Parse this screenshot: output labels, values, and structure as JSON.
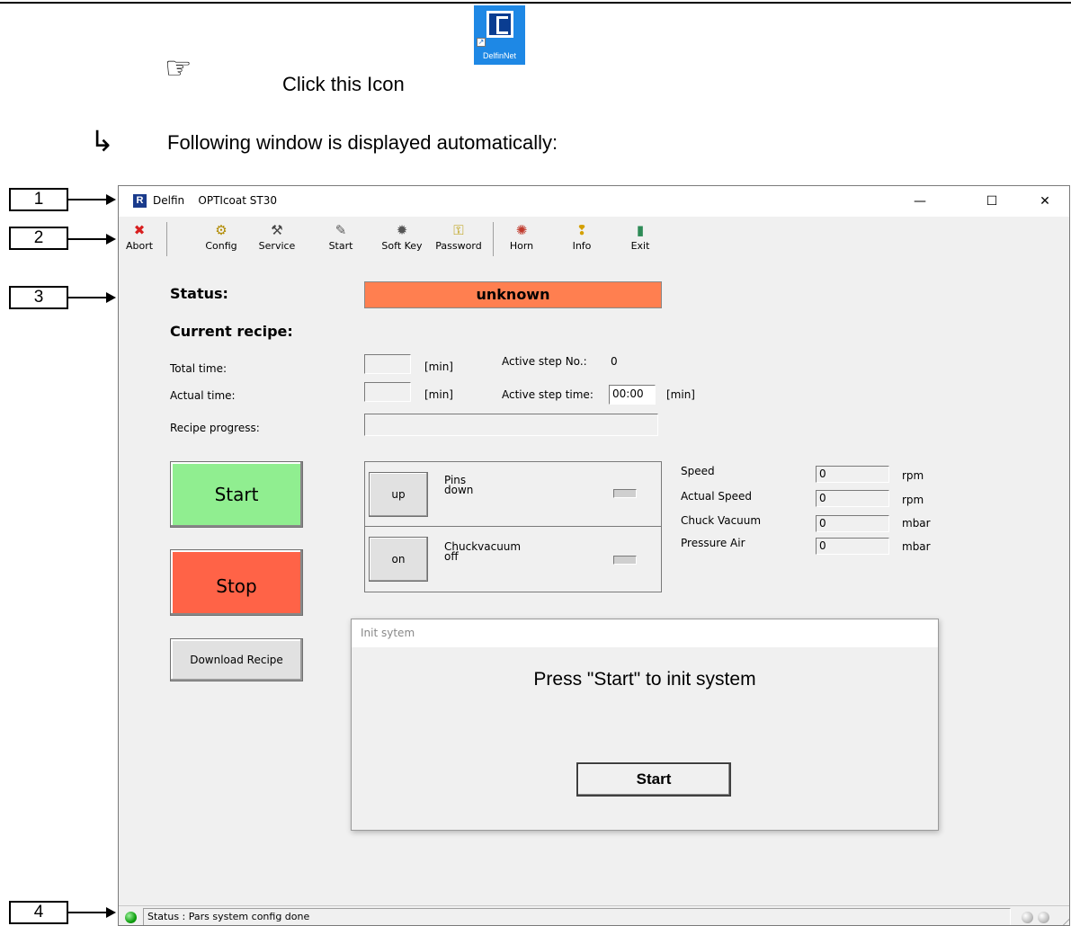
{
  "hint": {
    "hand_glyph": "☞",
    "text": "Click this Icon",
    "icon_caption": "DelfinNet",
    "icon_name": "delfinnet-app-icon"
  },
  "result": {
    "arrow_glyph": "↳",
    "text": "Following window is displayed automatically:"
  },
  "callouts": [
    "1",
    "2",
    "3",
    "4"
  ],
  "window": {
    "app_name": "Delfin",
    "title": "OPTIcoat ST30",
    "minimize_glyph": "—",
    "maximize_glyph": "☐",
    "close_glyph": "✕"
  },
  "toolbar": [
    {
      "label": "Abort",
      "icon": "abort-icon",
      "glyph": "✖",
      "color": "#d81f1f"
    },
    {
      "label": "Config",
      "icon": "config-icon",
      "glyph": "⚙",
      "color": "#b08a00"
    },
    {
      "label": "Service",
      "icon": "service-icon",
      "glyph": "⚒",
      "color": "#444444"
    },
    {
      "label": "Start",
      "icon": "start-icon",
      "glyph": "✎",
      "color": "#5a5a5a"
    },
    {
      "label": "Soft Key",
      "icon": "soft-key-icon",
      "glyph": "✹",
      "color": "#555555"
    },
    {
      "label": "Password",
      "icon": "password-icon",
      "glyph": "⚿",
      "color": "#b89a00"
    },
    {
      "label": "Horn",
      "icon": "horn-icon",
      "glyph": "✺",
      "color": "#c0392b"
    },
    {
      "label": "Info",
      "icon": "info-icon",
      "glyph": "❢",
      "color": "#d4a000"
    },
    {
      "label": "Exit",
      "icon": "exit-icon",
      "glyph": "▮",
      "color": "#2e8b57"
    }
  ],
  "status": {
    "label": "Status:",
    "value": "unknown",
    "color": "#ff7f50"
  },
  "current_recipe_label": "Current recipe:",
  "recipe": {
    "total_time_label": "Total time:",
    "total_time_value": "",
    "total_time_unit": "[min]",
    "actual_time_label": "Actual time:",
    "actual_time_value": "",
    "actual_time_unit": "[min]",
    "progress_label": "Recipe progress:",
    "progress": 0,
    "active_step_no_label": "Active step No.:",
    "active_step_no_value": "0",
    "active_step_time_label": "Active step time:",
    "active_step_time_value": "00:00",
    "active_step_time_unit": "[min]"
  },
  "buttons": {
    "start": "Start",
    "start_color": "#90ee90",
    "stop": "Stop",
    "stop_color": "#ff6347",
    "download": "Download Recipe"
  },
  "controls": [
    {
      "button": "up",
      "name": "Pins",
      "state": "down"
    },
    {
      "button": "on",
      "name": "Chuckvacuum",
      "state": "off"
    }
  ],
  "readings": [
    {
      "label": "Speed",
      "value": "0",
      "unit": "rpm"
    },
    {
      "label": "Actual Speed",
      "value": "0",
      "unit": "rpm"
    },
    {
      "label": "Chuck Vacuum",
      "value": "0",
      "unit": "mbar"
    },
    {
      "label": "Pressure Air",
      "value": "0",
      "unit": "mbar"
    }
  ],
  "dialog": {
    "title": "Init sytem",
    "message": "Press \"Start\" to init system",
    "button": "Start"
  },
  "statusbar": {
    "text": "Status : Pars system config done",
    "led_color": "#10a010"
  }
}
